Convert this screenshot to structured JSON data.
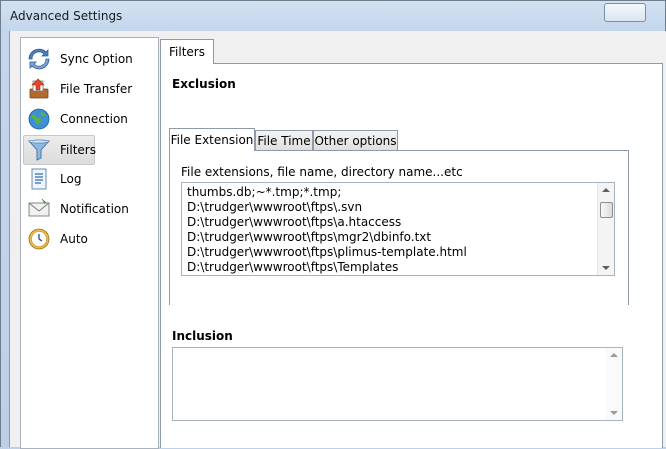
{
  "window": {
    "title": "Advanced Settings"
  },
  "nav": {
    "items": [
      {
        "label": "Sync Option",
        "icon": "sync-icon"
      },
      {
        "label": "File Transfer",
        "icon": "file-transfer-icon"
      },
      {
        "label": "Connection",
        "icon": "globe-icon"
      },
      {
        "label": "Filters",
        "icon": "funnel-icon",
        "active": true
      },
      {
        "label": "Log",
        "icon": "log-document-icon"
      },
      {
        "label": "Notification",
        "icon": "envelope-icon"
      },
      {
        "label": "Auto",
        "icon": "clock-icon"
      }
    ]
  },
  "main": {
    "tab_label": "Filters",
    "exclusion": {
      "label": "Exclusion",
      "tabs": [
        "File Extension",
        "File Time",
        "Other options"
      ],
      "active_tab": "File Extension",
      "hint": "File extensions, file name, directory name...etc",
      "lines": [
        "thumbs.db;~*.tmp;*.tmp;",
        "D:\\trudger\\wwwroot\\ftps\\.svn",
        "D:\\trudger\\wwwroot\\ftps\\a.htaccess",
        "D:\\trudger\\wwwroot\\ftps\\mgr2\\dbinfo.txt",
        "D:\\trudger\\wwwroot\\ftps\\plimus-template.html",
        "D:\\trudger\\wwwroot\\ftps\\Templates"
      ]
    },
    "inclusion": {
      "label": "Inclusion",
      "value": ""
    }
  }
}
